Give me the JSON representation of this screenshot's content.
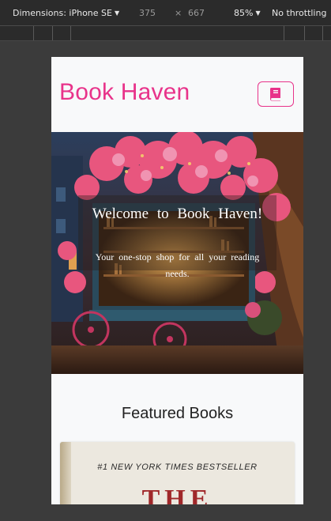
{
  "devtools": {
    "dimensions_label": "Dimensions: iPhone SE",
    "width": "375",
    "times": "×",
    "height": "667",
    "zoom": "85%",
    "throttling": "No throttling"
  },
  "site": {
    "brand": "Book Haven",
    "menu_icon": "book-icon",
    "hero": {
      "title": "Welcome to Book Haven!",
      "text": "Your one-stop shop for all your reading needs."
    },
    "featured": {
      "title": "Featured Books",
      "books": [
        {
          "cover_line": "#1 NEW YORK TIMES BESTSELLER",
          "cover_title": "THE"
        }
      ]
    }
  },
  "colors": {
    "brand": "#e8338a",
    "toolbar_bg": "#2b2b2b",
    "page_bg": "#f8f9fa"
  }
}
